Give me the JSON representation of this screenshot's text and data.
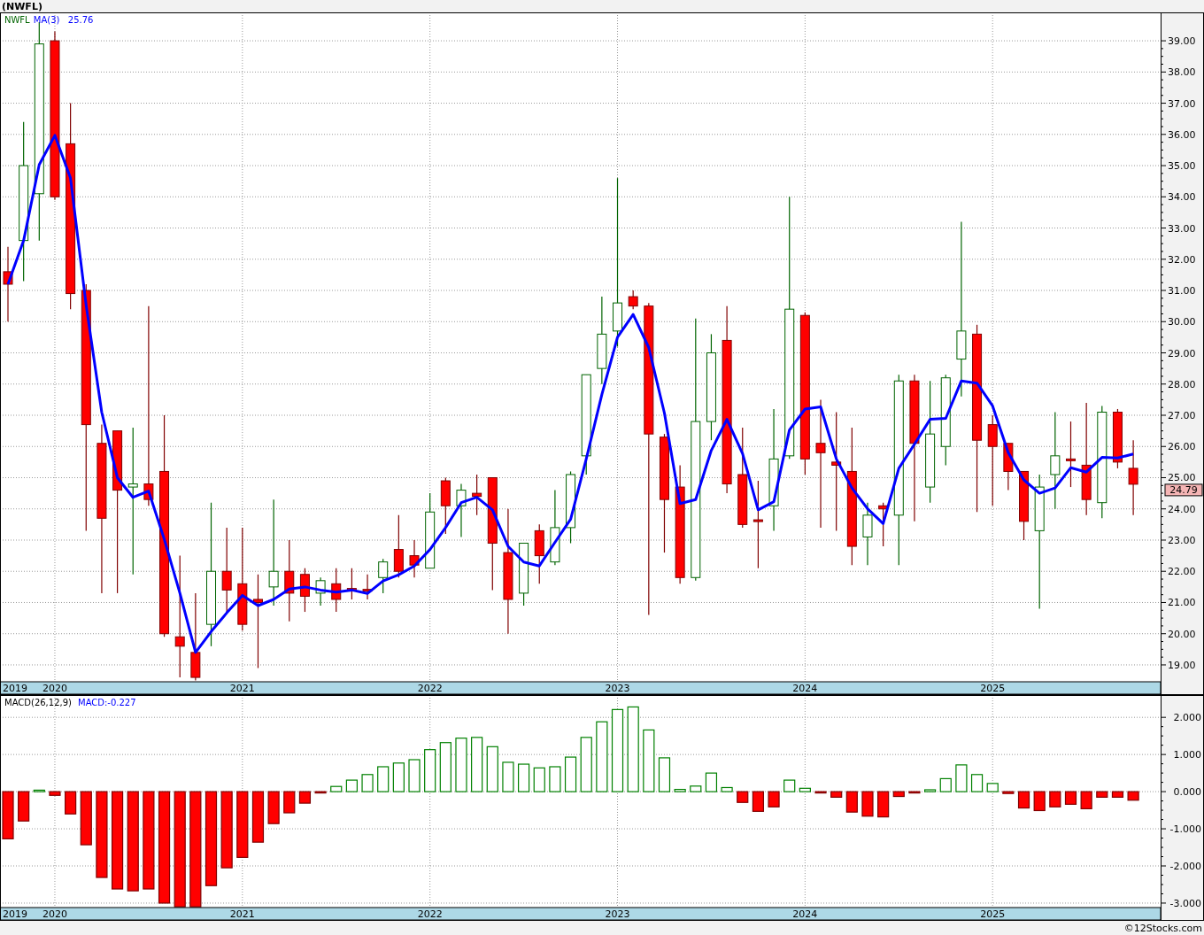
{
  "title": "(NWFL)",
  "price_chart": {
    "symbol": "NWFL",
    "first_year": "2019",
    "ma_reading": "25.76",
    "last_price": "24.79",
    "chart_data": {
      "type": "candlestick",
      "grid": true,
      "ylim": [
        18.46,
        39.91
      ],
      "categories": [
        null,
        null,
        null,
        "2020",
        null,
        null,
        null,
        null,
        null,
        null,
        null,
        null,
        null,
        null,
        null,
        "2021",
        null,
        null,
        null,
        null,
        null,
        null,
        null,
        null,
        null,
        null,
        null,
        "2022",
        null,
        null,
        null,
        null,
        null,
        null,
        null,
        null,
        null,
        null,
        null,
        "2023",
        null,
        null,
        null,
        null,
        null,
        null,
        null,
        null,
        null,
        null,
        null,
        "2024",
        null,
        null,
        null,
        null,
        null,
        null,
        null,
        null,
        null,
        null,
        null,
        "2025",
        null,
        null,
        null,
        null,
        null,
        null,
        null,
        null,
        null
      ],
      "yticks": [
        {
          "value": 39,
          "label": "39.00"
        },
        {
          "value": 38,
          "label": "38.00"
        },
        {
          "value": 37,
          "label": "37.00"
        },
        {
          "value": 36,
          "label": "36.00"
        },
        {
          "value": 35,
          "label": "35.00"
        },
        {
          "value": 34,
          "label": "34.00"
        },
        {
          "value": 33,
          "label": "33.00"
        },
        {
          "value": 32,
          "label": "32.00"
        },
        {
          "value": 31,
          "label": "31.00"
        },
        {
          "value": 30,
          "label": "30.00"
        },
        {
          "value": 29,
          "label": "29.00"
        },
        {
          "value": 28,
          "label": "28.00"
        },
        {
          "value": 27,
          "label": "27.00"
        },
        {
          "value": 26,
          "label": "26.00"
        },
        {
          "value": 25,
          "label": "25.00"
        },
        {
          "value": 24,
          "label": "24.00"
        },
        {
          "value": 23,
          "label": "23.00"
        },
        {
          "value": 22,
          "label": "22.00"
        },
        {
          "value": 21,
          "label": "21.00"
        },
        {
          "value": 20,
          "label": "20.00"
        },
        {
          "value": 19,
          "label": "19.00"
        }
      ],
      "ohlc": [
        [
          31.6,
          32.4,
          30.0,
          31.2
        ],
        [
          32.6,
          36.4,
          31.3,
          35.0
        ],
        [
          34.1,
          39.6,
          32.6,
          38.9
        ],
        [
          39.0,
          39.3,
          33.9,
          34.0
        ],
        [
          35.7,
          37.0,
          30.4,
          30.9
        ],
        [
          31.0,
          31.2,
          23.3,
          26.7
        ],
        [
          26.1,
          26.7,
          21.3,
          23.7
        ],
        [
          26.5,
          26.5,
          21.3,
          24.6
        ],
        [
          24.7,
          26.6,
          21.9,
          24.8
        ],
        [
          24.8,
          30.5,
          24.1,
          24.3
        ],
        [
          25.2,
          27.0,
          19.9,
          20.0
        ],
        [
          19.9,
          22.5,
          18.6,
          19.6
        ],
        [
          19.4,
          21.3,
          18.5,
          18.6
        ],
        [
          20.3,
          24.2,
          19.6,
          22.0
        ],
        [
          22.0,
          23.4,
          20.7,
          21.4
        ],
        [
          21.6,
          23.4,
          20.1,
          20.3
        ],
        [
          21.1,
          21.9,
          18.9,
          21.0
        ],
        [
          21.5,
          24.3,
          20.9,
          22.0
        ],
        [
          22.0,
          23.0,
          20.4,
          21.3
        ],
        [
          21.9,
          22.1,
          20.7,
          21.2
        ],
        [
          21.3,
          21.8,
          20.9,
          21.7
        ],
        [
          21.6,
          22.1,
          20.7,
          21.1
        ],
        [
          21.45,
          22.1,
          21.1,
          21.4
        ],
        [
          21.42,
          21.9,
          21.1,
          21.38
        ],
        [
          21.8,
          22.4,
          21.3,
          22.3
        ],
        [
          22.7,
          23.8,
          21.8,
          22.0
        ],
        [
          22.5,
          23.0,
          21.8,
          22.2
        ],
        [
          22.1,
          24.5,
          22.1,
          23.9
        ],
        [
          24.9,
          25.0,
          23.2,
          24.1
        ],
        [
          24.1,
          24.8,
          23.1,
          24.6
        ],
        [
          24.5,
          25.1,
          23.8,
          24.4
        ],
        [
          25.0,
          25.0,
          21.4,
          22.9
        ],
        [
          22.6,
          24.0,
          20.0,
          21.1
        ],
        [
          21.3,
          22.9,
          20.9,
          22.9
        ],
        [
          23.3,
          23.5,
          21.6,
          22.5
        ],
        [
          22.3,
          24.6,
          22.2,
          23.4
        ],
        [
          23.4,
          25.2,
          22.9,
          25.1
        ],
        [
          25.7,
          28.3,
          25.1,
          28.3
        ],
        [
          28.5,
          30.8,
          28.0,
          29.6
        ],
        [
          29.7,
          34.6,
          29.2,
          30.6
        ],
        [
          30.8,
          31.0,
          30.4,
          30.5
        ],
        [
          30.5,
          30.6,
          20.6,
          26.4
        ],
        [
          26.3,
          26.4,
          22.6,
          24.3
        ],
        [
          24.7,
          25.4,
          21.6,
          21.8
        ],
        [
          21.8,
          30.1,
          21.7,
          26.8
        ],
        [
          26.8,
          29.6,
          26.2,
          29.0
        ],
        [
          29.4,
          30.5,
          24.5,
          24.8
        ],
        [
          25.1,
          26.6,
          23.4,
          23.5
        ],
        [
          23.65,
          24.9,
          22.1,
          23.6
        ],
        [
          24.1,
          27.2,
          23.3,
          25.6
        ],
        [
          25.7,
          34.0,
          25.6,
          30.4
        ],
        [
          30.2,
          30.3,
          25.1,
          25.6
        ],
        [
          26.1,
          27.5,
          23.4,
          25.8
        ],
        [
          25.5,
          27.1,
          23.3,
          25.4
        ],
        [
          25.2,
          26.6,
          22.2,
          22.8
        ],
        [
          23.1,
          24.2,
          22.2,
          23.8
        ],
        [
          24.1,
          24.2,
          22.8,
          24.0
        ],
        [
          23.8,
          28.3,
          22.2,
          28.1
        ],
        [
          28.1,
          28.3,
          23.6,
          26.1
        ],
        [
          24.7,
          28.1,
          24.2,
          26.4
        ],
        [
          26.0,
          28.3,
          25.4,
          28.2
        ],
        [
          28.8,
          33.2,
          27.6,
          29.7
        ],
        [
          29.6,
          29.9,
          23.9,
          26.2
        ],
        [
          26.7,
          27.0,
          24.1,
          26.0
        ],
        [
          26.1,
          26.1,
          24.6,
          25.2
        ],
        [
          25.2,
          25.2,
          23.0,
          23.6
        ],
        [
          23.3,
          25.1,
          20.8,
          24.7
        ],
        [
          25.1,
          27.1,
          24.0,
          25.7
        ],
        [
          25.6,
          26.8,
          24.7,
          25.55
        ],
        [
          25.4,
          27.4,
          23.8,
          24.3
        ],
        [
          24.2,
          27.3,
          23.7,
          27.1
        ],
        [
          27.1,
          27.2,
          25.3,
          25.5
        ],
        [
          25.3,
          26.2,
          23.8,
          24.79
        ]
      ],
      "series": [
        {
          "name": "MA(3)",
          "type": "line",
          "color": "#0000ff",
          "values": [
            31.2,
            32.6,
            35.03,
            35.97,
            34.6,
            30.53,
            27.1,
            25.0,
            24.37,
            24.57,
            23.03,
            21.3,
            19.4,
            20.07,
            20.67,
            21.23,
            20.9,
            21.1,
            21.43,
            21.5,
            21.4,
            21.33,
            21.4,
            21.29,
            21.69,
            21.89,
            22.17,
            22.7,
            23.4,
            24.2,
            24.37,
            23.97,
            22.8,
            22.3,
            22.17,
            22.93,
            23.67,
            25.6,
            27.67,
            29.5,
            30.23,
            29.17,
            27.07,
            24.17,
            24.3,
            25.87,
            26.87,
            25.77,
            23.97,
            24.23,
            26.53,
            27.2,
            27.27,
            25.6,
            24.67,
            24.0,
            23.53,
            25.3,
            26.07,
            26.87,
            26.9,
            28.1,
            28.03,
            27.3,
            25.8,
            24.93,
            24.5,
            24.67,
            25.32,
            25.18,
            25.65,
            25.63,
            25.76
          ]
        }
      ]
    }
  },
  "macd_chart": {
    "title": "MACD(26,12,9)",
    "first_year": "2019",
    "reading": "MACD:-0.227",
    "chart_data": {
      "type": "bar",
      "grid": true,
      "ylim": [
        -3.12,
        2.6
      ],
      "categories": [
        null,
        null,
        null,
        "2020",
        null,
        null,
        null,
        null,
        null,
        null,
        null,
        null,
        null,
        null,
        null,
        "2021",
        null,
        null,
        null,
        null,
        null,
        null,
        null,
        null,
        null,
        null,
        null,
        "2022",
        null,
        null,
        null,
        null,
        null,
        null,
        null,
        null,
        null,
        null,
        null,
        "2023",
        null,
        null,
        null,
        null,
        null,
        null,
        null,
        null,
        null,
        null,
        null,
        "2024",
        null,
        null,
        null,
        null,
        null,
        null,
        null,
        null,
        null,
        null,
        null,
        "2025",
        null,
        null,
        null,
        null,
        null,
        null,
        null,
        null,
        null
      ],
      "yticks": [
        {
          "value": 2,
          "label": "2.000"
        },
        {
          "value": 1,
          "label": "1.000"
        },
        {
          "value": 0,
          "label": "0.000"
        },
        {
          "value": -1,
          "label": "-1.000"
        },
        {
          "value": -2,
          "label": "-2.000"
        },
        {
          "value": -3,
          "label": "-3.000"
        }
      ],
      "series": [
        {
          "color": "#008000",
          "values": [
            null,
            null,
            0.04,
            null,
            null,
            null,
            null,
            null,
            null,
            null,
            null,
            null,
            null,
            null,
            null,
            null,
            null,
            null,
            null,
            null,
            null,
            0.14,
            0.31,
            0.46,
            0.67,
            0.77,
            0.86,
            1.13,
            1.32,
            1.44,
            1.46,
            1.21,
            0.79,
            0.74,
            0.64,
            0.67,
            0.93,
            1.46,
            1.88,
            2.21,
            2.28,
            1.66,
            0.91,
            0.06,
            0.15,
            0.5,
            0.11,
            null,
            null,
            null,
            0.31,
            0.09,
            null,
            null,
            null,
            null,
            null,
            null,
            null,
            0.05,
            0.35,
            0.72,
            0.46,
            0.22,
            null,
            null,
            null,
            null,
            null,
            null,
            null,
            null,
            null
          ]
        },
        {
          "color": "#ff0000",
          "values": [
            -1.27,
            -0.79,
            null,
            -0.1,
            -0.6,
            -1.43,
            -2.31,
            -2.62,
            -2.67,
            -2.62,
            -3.0,
            -3.1,
            -3.1,
            -2.53,
            -2.05,
            -1.77,
            -1.36,
            -0.86,
            -0.57,
            -0.31,
            -0.02,
            null,
            null,
            null,
            null,
            null,
            null,
            null,
            null,
            null,
            null,
            null,
            null,
            null,
            null,
            null,
            null,
            null,
            null,
            null,
            null,
            null,
            null,
            null,
            null,
            null,
            null,
            -0.29,
            -0.53,
            -0.41,
            null,
            null,
            -0.01,
            -0.15,
            -0.55,
            -0.66,
            -0.68,
            -0.13,
            -0.03,
            null,
            null,
            null,
            null,
            null,
            -0.05,
            -0.44,
            -0.51,
            -0.41,
            -0.34,
            -0.46,
            -0.15,
            -0.15,
            -0.23
          ]
        }
      ]
    }
  },
  "footer": "©12Stocks.com"
}
